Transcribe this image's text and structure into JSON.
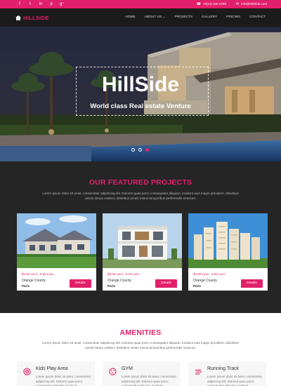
{
  "topbar": {
    "social": [
      {
        "icon": "facebook-icon",
        "glyph": "f"
      },
      {
        "icon": "twitter-icon",
        "glyph": "t"
      },
      {
        "icon": "linkedin-icon",
        "glyph": "in"
      },
      {
        "icon": "pinterest-icon",
        "glyph": "p"
      },
      {
        "icon": "google-plus-icon",
        "glyph": "g⁺"
      }
    ],
    "phone": "+0(12) 345 6789",
    "email": "info@HillSide.com"
  },
  "navbar": {
    "logo_text": "HILLSIDE",
    "items": [
      "HOME",
      "ABOUT US ⌄",
      "PROJECTS",
      "GALLERY",
      "PRICING",
      "CONTACT"
    ]
  },
  "hero": {
    "title": "HillSide",
    "subtitle": "World class Real estate Venture",
    "slides": 3,
    "active_slide": 3
  },
  "featured": {
    "title": "OUR FEATURED PROJECTS",
    "desc": "Lorem ipsum dolor sit amet, consectetur adipiscing elit. Dolores quae porro consequatur aliquam, incidunt eius magni provident, doloribus omnis minus ovident, doloribus omnis minus temporibus perferendis nesciunt.",
    "cards": [
      {
        "price": "$4.00 Lacs - 6.28 Lacs",
        "location": "Orange County",
        "city": "Paris",
        "button": "Details"
      },
      {
        "price": "$4.00 Lacs - 6.28 Lacs",
        "location": "Orange County",
        "city": "Paris",
        "button": "Details"
      },
      {
        "price": "$4.00 Lacs - 6.28 Lacs",
        "location": "Orange County",
        "city": "Paris",
        "button": "Details"
      }
    ]
  },
  "amenities": {
    "title": "AMENITIES",
    "desc": "Lorem ipsum dolor sit amet, consectetur adipiscing elit. Dolores quae porro consequatur aliquam, incidunt eius magni provident, doloribus omnis minus ovident, doloribus omnis minus temporibus perferendis nesciunt.",
    "items": [
      {
        "icon": "target-icon",
        "title": "Kids Play Area",
        "text": "Lorem ipsum dolor sit amet, consectetur adipiscing elit. Dolores quae porro consequatur aliquam, incidunt"
      },
      {
        "icon": "gym-icon",
        "title": "GYM",
        "text": "Lorem ipsum dolor sit amet, consectetur adipiscing elit. Dolores quae porro consequatur aliquam, incidunt"
      },
      {
        "icon": "running-track-icon",
        "title": "Running Track",
        "text": "Lorem ipsum dolor sit amet, consectetur adipiscing elit. Dolores quae porro consequatur aliquam, incidunt"
      }
    ]
  },
  "colors": {
    "accent": "#e2206a",
    "dark": "#252525",
    "nav": "#1b1b1b"
  }
}
